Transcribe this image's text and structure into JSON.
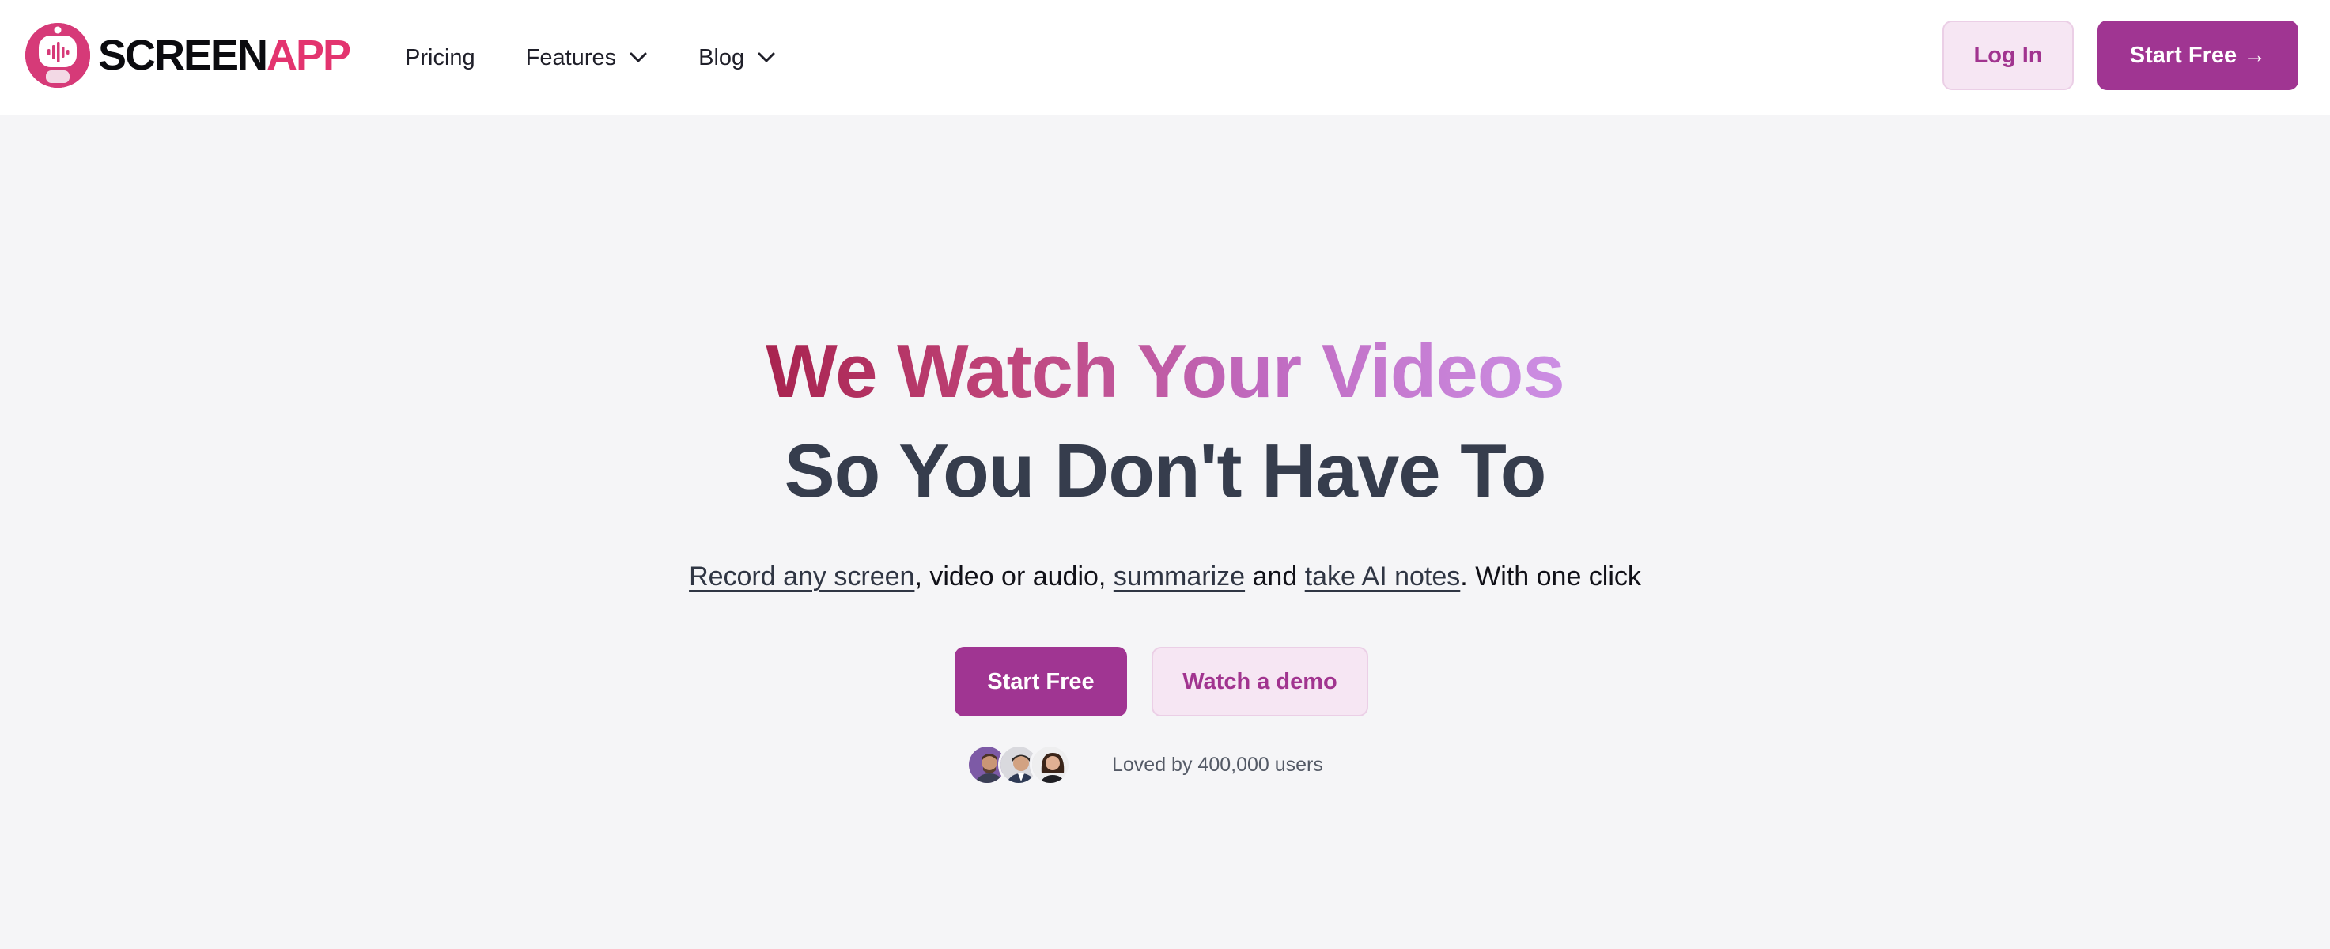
{
  "brand": {
    "name_part1": "SCREEN",
    "name_part2": "APP",
    "logo_icon": "robot-mic-icon",
    "colors": {
      "primary": "#a03592",
      "brand_pink": "#e3346f",
      "soft_bg": "#f6e6f3"
    }
  },
  "nav": {
    "items": [
      {
        "label": "Pricing",
        "has_dropdown": false
      },
      {
        "label": "Features",
        "has_dropdown": true
      },
      {
        "label": "Blog",
        "has_dropdown": true
      }
    ],
    "login_label": "Log In",
    "start_free_label": "Start Free →"
  },
  "hero": {
    "headline_line1": "We Watch Your Videos",
    "headline_line2": "So You Don't Have To",
    "sub": {
      "link1": "Record any screen",
      "text1": ", video or audio, ",
      "link2": "summarize",
      "text2": " and ",
      "link3": "take AI notes",
      "text3": ". With one click"
    },
    "cta_primary": "Start Free",
    "cta_secondary": "Watch a demo",
    "social_proof": "Loved by 400,000 users"
  }
}
